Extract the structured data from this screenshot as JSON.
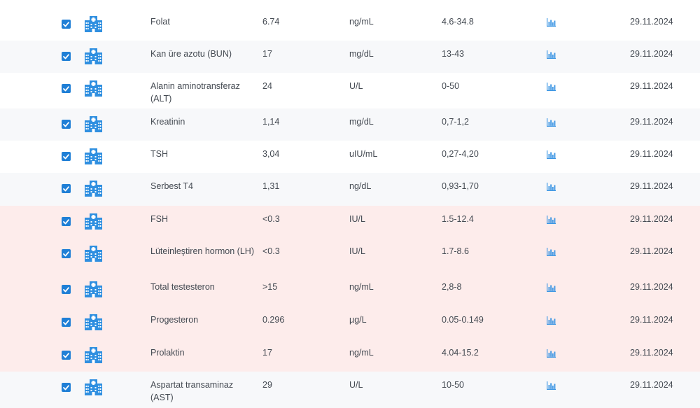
{
  "rows": [
    {
      "name": "Folat",
      "value": "6.74",
      "unit": "ng/mL",
      "ref": "4.6-34.8",
      "date": "29.11.2024",
      "checked": true,
      "abnormal": false
    },
    {
      "name": "Kan üre azotu (BUN)",
      "value": "17",
      "unit": "mg/dL",
      "ref": "13-43",
      "date": "29.11.2024",
      "checked": true,
      "abnormal": false
    },
    {
      "name": "Alanin aminotransferaz (ALT)",
      "value": "24",
      "unit": "U/L",
      "ref": "0-50",
      "date": "29.11.2024",
      "checked": true,
      "abnormal": false
    },
    {
      "name": "Kreatinin",
      "value": "1,14",
      "unit": "mg/dL",
      "ref": "0,7-1,2",
      "date": "29.11.2024",
      "checked": true,
      "abnormal": false
    },
    {
      "name": "TSH",
      "value": "3,04",
      "unit": "uIU/mL",
      "ref": "0,27-4,20",
      "date": "29.11.2024",
      "checked": true,
      "abnormal": false
    },
    {
      "name": "Serbest T4",
      "value": "1,31",
      "unit": "ng/dL",
      "ref": "0,93-1,70",
      "date": "29.11.2024",
      "checked": true,
      "abnormal": false
    },
    {
      "name": "FSH",
      "value": "<0.3",
      "unit": "IU/L",
      "ref": "1.5-12.4",
      "date": "29.11.2024",
      "checked": true,
      "abnormal": true
    },
    {
      "name": "Lüteinleştiren hormon (LH)",
      "value": "<0.3",
      "unit": "IU/L",
      "ref": "1.7-8.6",
      "date": "29.11.2024",
      "checked": true,
      "abnormal": true
    },
    {
      "name": "Total testesteron",
      "value": ">15",
      "unit": "ng/mL",
      "ref": "2,8-8",
      "date": "29.11.2024",
      "checked": true,
      "abnormal": true
    },
    {
      "name": "Progesteron",
      "value": "0.296",
      "unit": "µg/L",
      "ref": "0.05-0.149",
      "date": "29.11.2024",
      "checked": true,
      "abnormal": true
    },
    {
      "name": "Prolaktin",
      "value": "17",
      "unit": "ng/mL",
      "ref": "4.04-15.2",
      "date": "29.11.2024",
      "checked": true,
      "abnormal": true
    },
    {
      "name": "Aspartat transaminaz (AST)",
      "value": "29",
      "unit": "U/L",
      "ref": "10-50",
      "date": "29.11.2024",
      "checked": true,
      "abnormal": false
    }
  ],
  "icons": {
    "source": "hospital-icon",
    "trend": "bar-chart-icon",
    "check": "check-icon"
  },
  "colors": {
    "checkbox": "#1f7fd6",
    "hospital_icon": "#2f8fe0",
    "chart_icon": "#3b95e3",
    "abnormal_row": "#fdeceb",
    "alt_row": "#f7f8fa"
  }
}
